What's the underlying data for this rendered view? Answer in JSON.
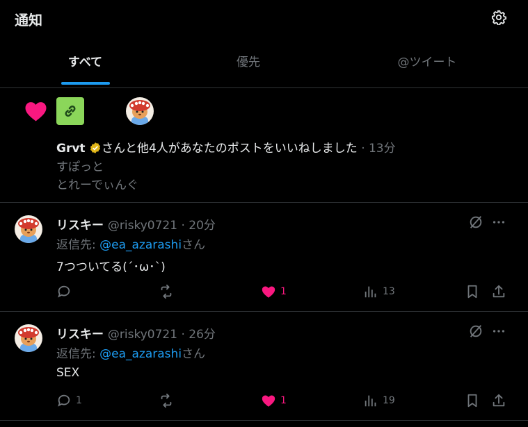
{
  "header": {
    "title": "通知"
  },
  "tabs": [
    {
      "label": "すべて",
      "active": true
    },
    {
      "label": "優先",
      "active": false
    },
    {
      "label": "@ツイート",
      "active": false
    }
  ],
  "like_notification": {
    "user": "Grvt",
    "message": "さんと他4人があなたのポストをいいねしました",
    "time": "· 13分",
    "preview_line1": "すぽっと",
    "preview_line2": "とれーでぃんぐ"
  },
  "tweets": [
    {
      "name": "リスキー",
      "handle": "@risky0721 · 20分",
      "reply_prefix": "返信先: ",
      "reply_to": "@ea_azarashi",
      "reply_suffix": "さん",
      "text": "7つついてる(´･ω･`)",
      "replies": "",
      "retweets": "",
      "likes": "1",
      "views": "13"
    },
    {
      "name": "リスキー",
      "handle": "@risky0721 · 26分",
      "reply_prefix": "返信先: ",
      "reply_to": "@ea_azarashi",
      "reply_suffix": "さん",
      "text": "SEX",
      "replies": "1",
      "retweets": "",
      "likes": "1",
      "views": "19"
    }
  ],
  "colors": {
    "accent": "#1d9bf0",
    "like": "#f91880",
    "muted": "#71767b",
    "border": "#2f3336"
  }
}
